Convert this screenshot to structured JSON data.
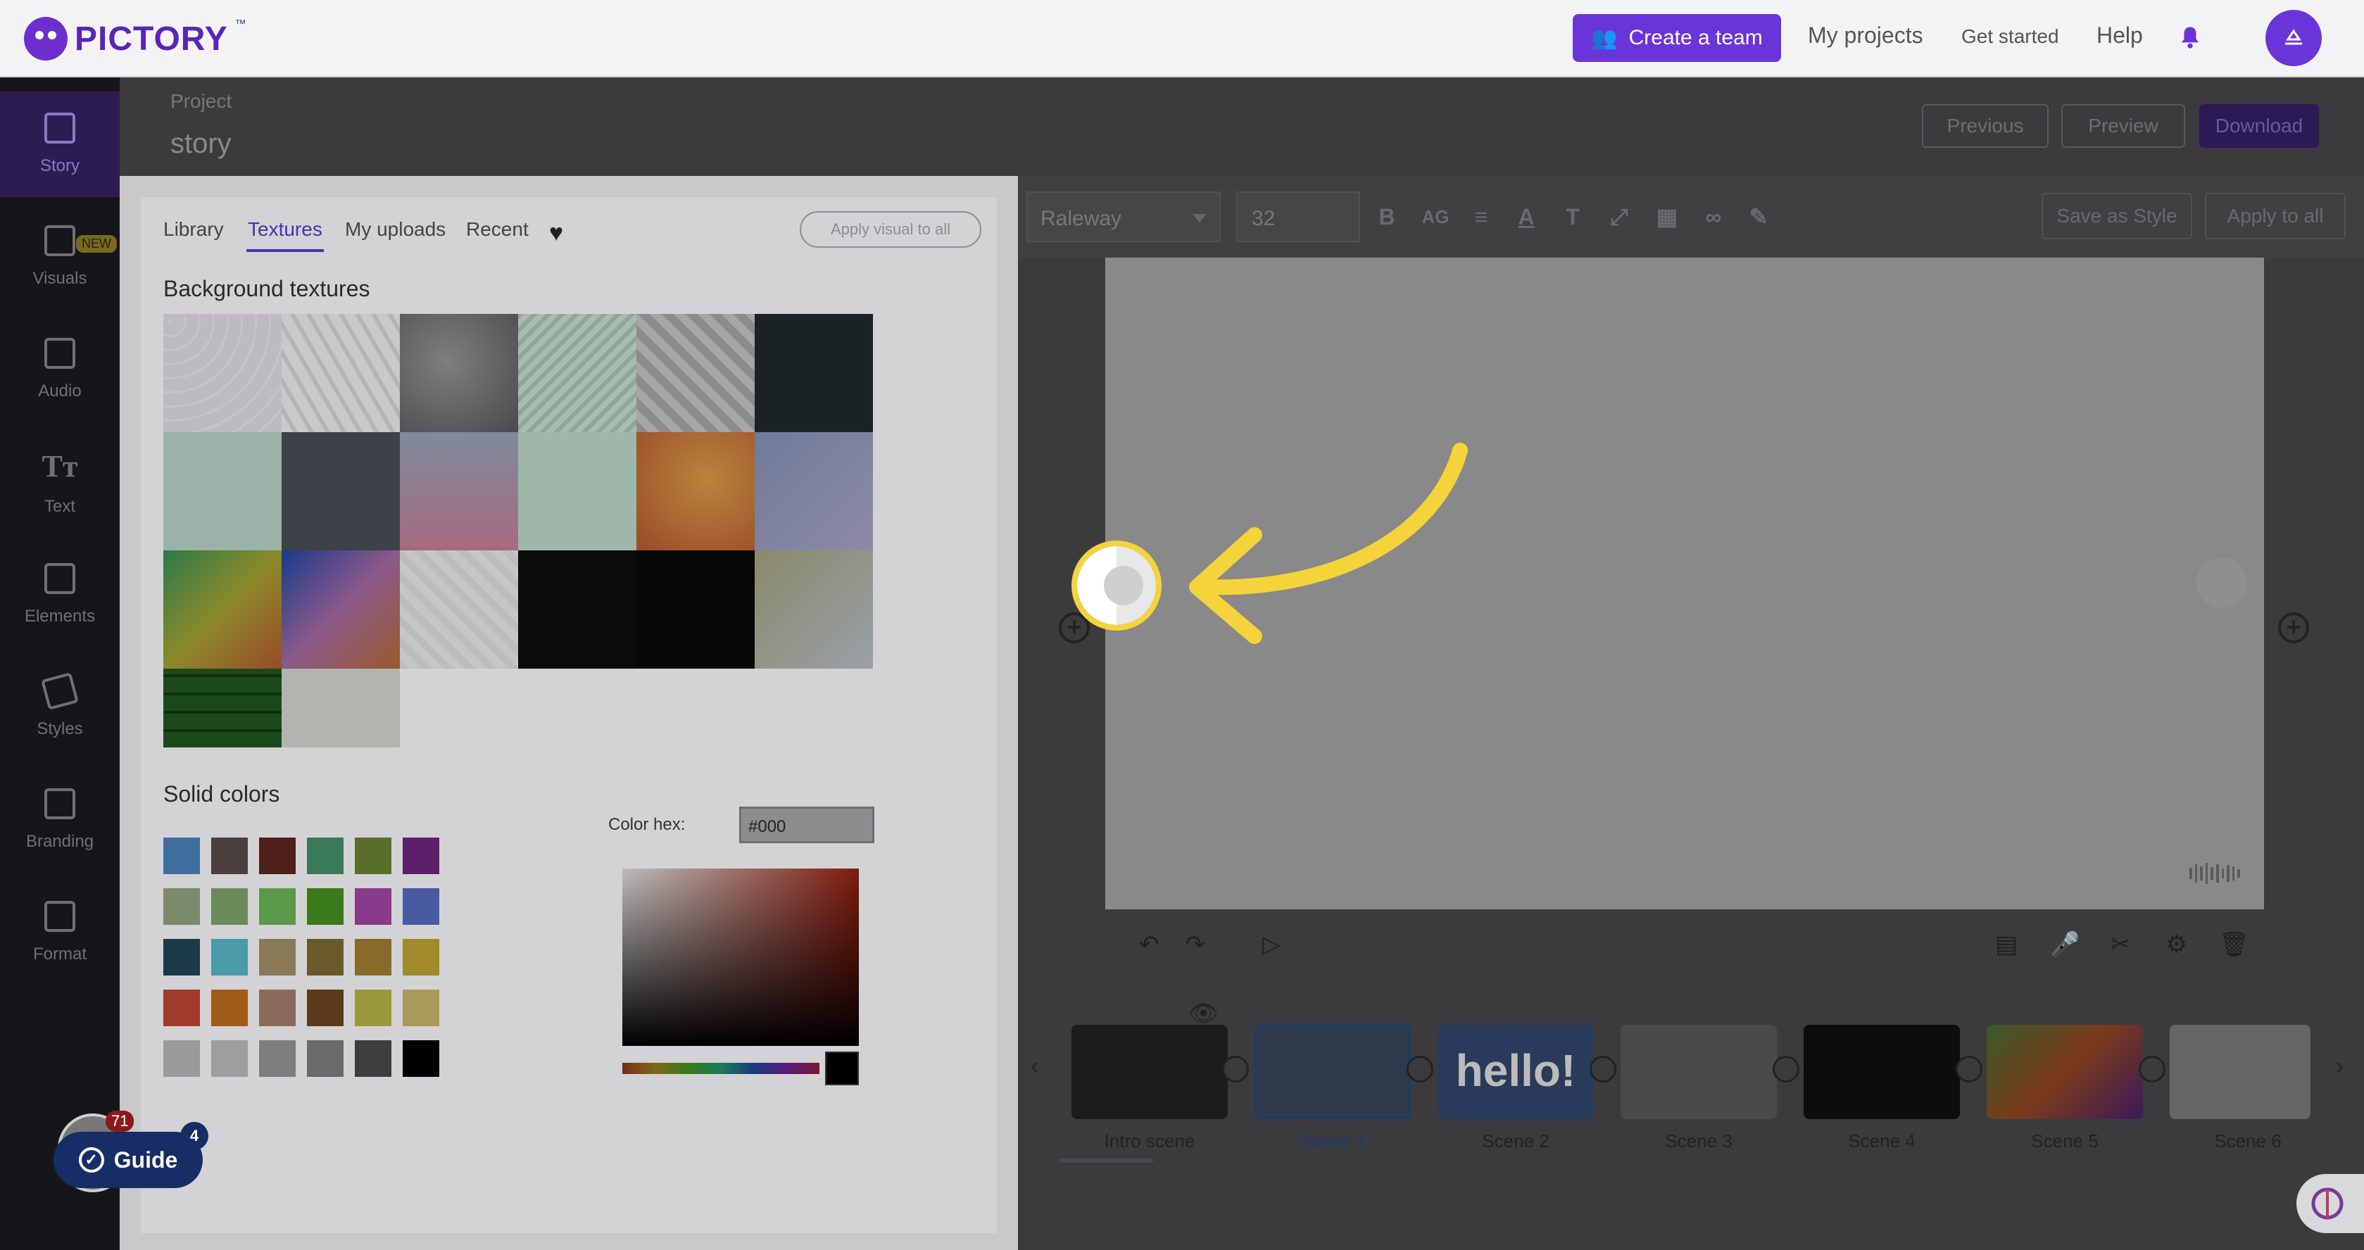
{
  "brand": {
    "name": "PICTORY",
    "tm": "™"
  },
  "nav": {
    "create_team": "Create a team",
    "my_projects": "My projects",
    "get_started": "Get started",
    "help": "Help"
  },
  "sidebar": {
    "items": [
      {
        "label": "Story",
        "icon": "grid-icon"
      },
      {
        "label": "Visuals",
        "icon": "image-icon"
      },
      {
        "label": "Audio",
        "icon": "music-icon"
      },
      {
        "label": "Text",
        "icon": "text-icon"
      },
      {
        "label": "Elements",
        "icon": "shapes-icon"
      },
      {
        "label": "Styles",
        "icon": "palette-icon"
      },
      {
        "label": "Branding",
        "icon": "briefcase-icon"
      },
      {
        "label": "Format",
        "icon": "aspect-ratio-icon"
      }
    ],
    "new_badge": "NEW"
  },
  "project": {
    "label": "Project",
    "title": "story",
    "previous": "Previous",
    "preview": "Preview",
    "download": "Download"
  },
  "toolbar": {
    "font": "Raleway",
    "size": "32",
    "bold": "B",
    "allcaps": "AG",
    "save_style": "Save as Style",
    "apply_all": "Apply to all"
  },
  "panel": {
    "tabs": [
      "Library",
      "Textures",
      "My uploads",
      "Recent"
    ],
    "active_tab": "Textures",
    "apply_visual": "Apply visual to all",
    "bg_textures_title": "Background textures",
    "solid_colors_title": "Solid colors",
    "hex_label": "Color hex:",
    "hex_value": "#000",
    "swatches": [
      [
        "#3e6e9e",
        "#4a3f3c",
        "#4f1f1a",
        "#3a7a5a",
        "#5a6e2a",
        "#5e1f6a"
      ],
      [
        "#7a8a6a",
        "#6a8a5a",
        "#5a9a4a",
        "#3a7a1a",
        "#8a3a8a",
        "#4a5aa0"
      ],
      [
        "#1a3a4a",
        "#4a9aaa",
        "#8a7a5a",
        "#6a5a2a",
        "#8a6a2a",
        "#a08a2a"
      ],
      [
        "#a03a2a",
        "#a05a1a",
        "#8a6a5a",
        "#5a3a1a",
        "#9a9a3a",
        "#aa9a5a"
      ],
      [
        "#9a9a9a",
        "#9e9e9e",
        "#7e7e7e",
        "#6a6a6a",
        "#3e3e3e",
        "#000000"
      ]
    ]
  },
  "scenes": [
    "Intro scene",
    "Scene 1",
    "Scene 2",
    "Scene 3",
    "Scene 4",
    "Scene 5",
    "Scene 6"
  ],
  "scene2_text": "hello!",
  "guide": {
    "label": "Guide",
    "count": "4",
    "notifications": "71"
  },
  "colors": {
    "accent": "#6a35d8",
    "highlight": "#f5d33a",
    "selected_scene": "#1e3a66"
  }
}
